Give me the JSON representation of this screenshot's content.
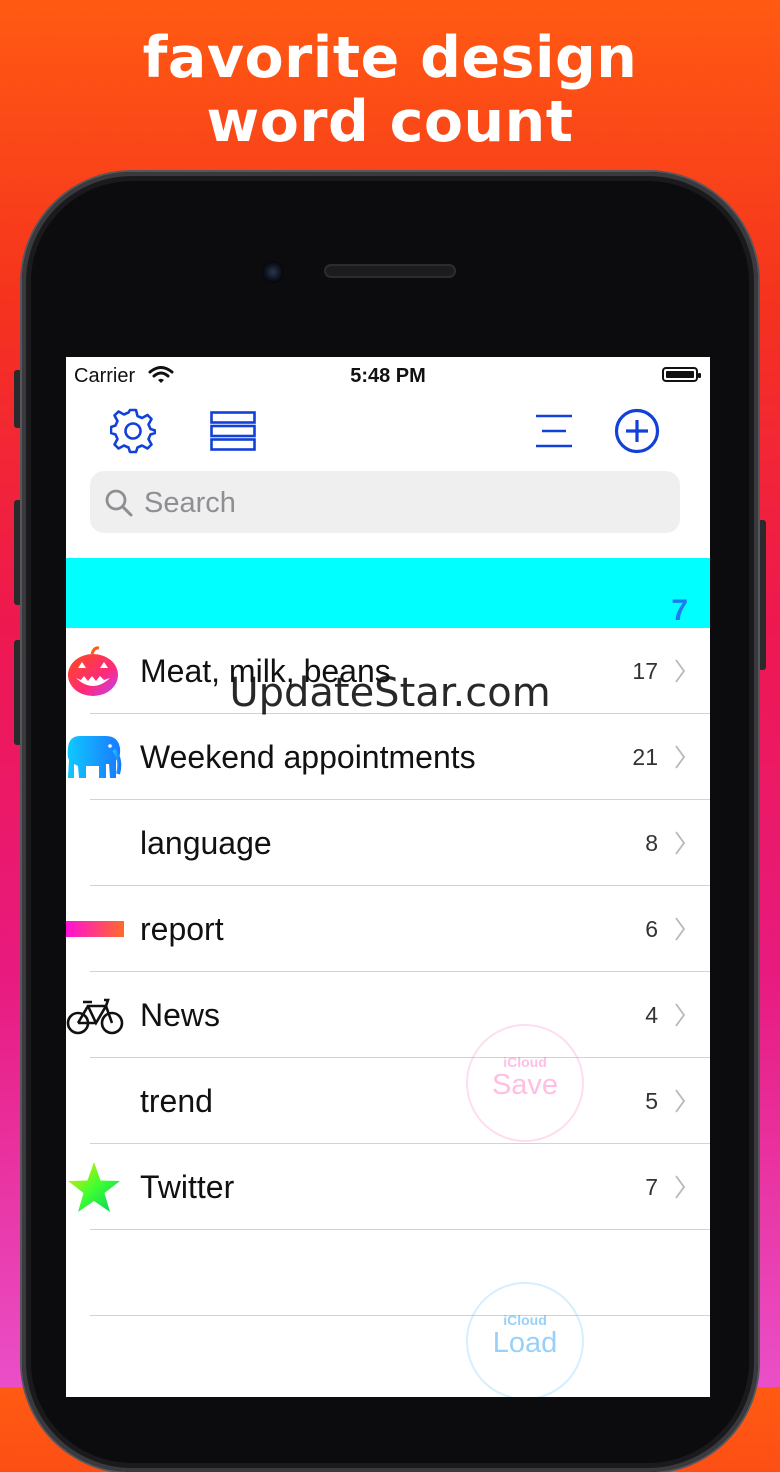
{
  "promo": {
    "line1": "favorite design",
    "line2": "word count"
  },
  "status_bar": {
    "carrier": "Carrier",
    "time": "5:48 PM"
  },
  "toolbar": {
    "icons": [
      "gear-icon",
      "list-layout-icon",
      "sort-lines-icon",
      "add-circle-icon"
    ],
    "accent_color": "#1141d8"
  },
  "search": {
    "placeholder": "Search",
    "value": ""
  },
  "banner": {
    "count": "7",
    "color": "#00ffff"
  },
  "list": {
    "items": [
      {
        "label": "Meat, milk, beans",
        "count": "17",
        "icon": "pumpkin-icon"
      },
      {
        "label": "Weekend appointments",
        "count": "21",
        "icon": "elephant-icon"
      },
      {
        "label": "language",
        "count": "8",
        "icon": ""
      },
      {
        "label": "report",
        "count": "6",
        "icon": "gradient-bar-icon"
      },
      {
        "label": "News",
        "count": "4",
        "icon": "bicycle-icon"
      },
      {
        "label": "trend",
        "count": "5",
        "icon": ""
      },
      {
        "label": "Twitter",
        "count": "7",
        "icon": "star-icon"
      }
    ]
  },
  "icloud_save": {
    "small": "iCloud",
    "big": "Save"
  },
  "icloud_load": {
    "small": "iCloud",
    "big": "Load"
  },
  "watermark": "UpdateStar.com"
}
